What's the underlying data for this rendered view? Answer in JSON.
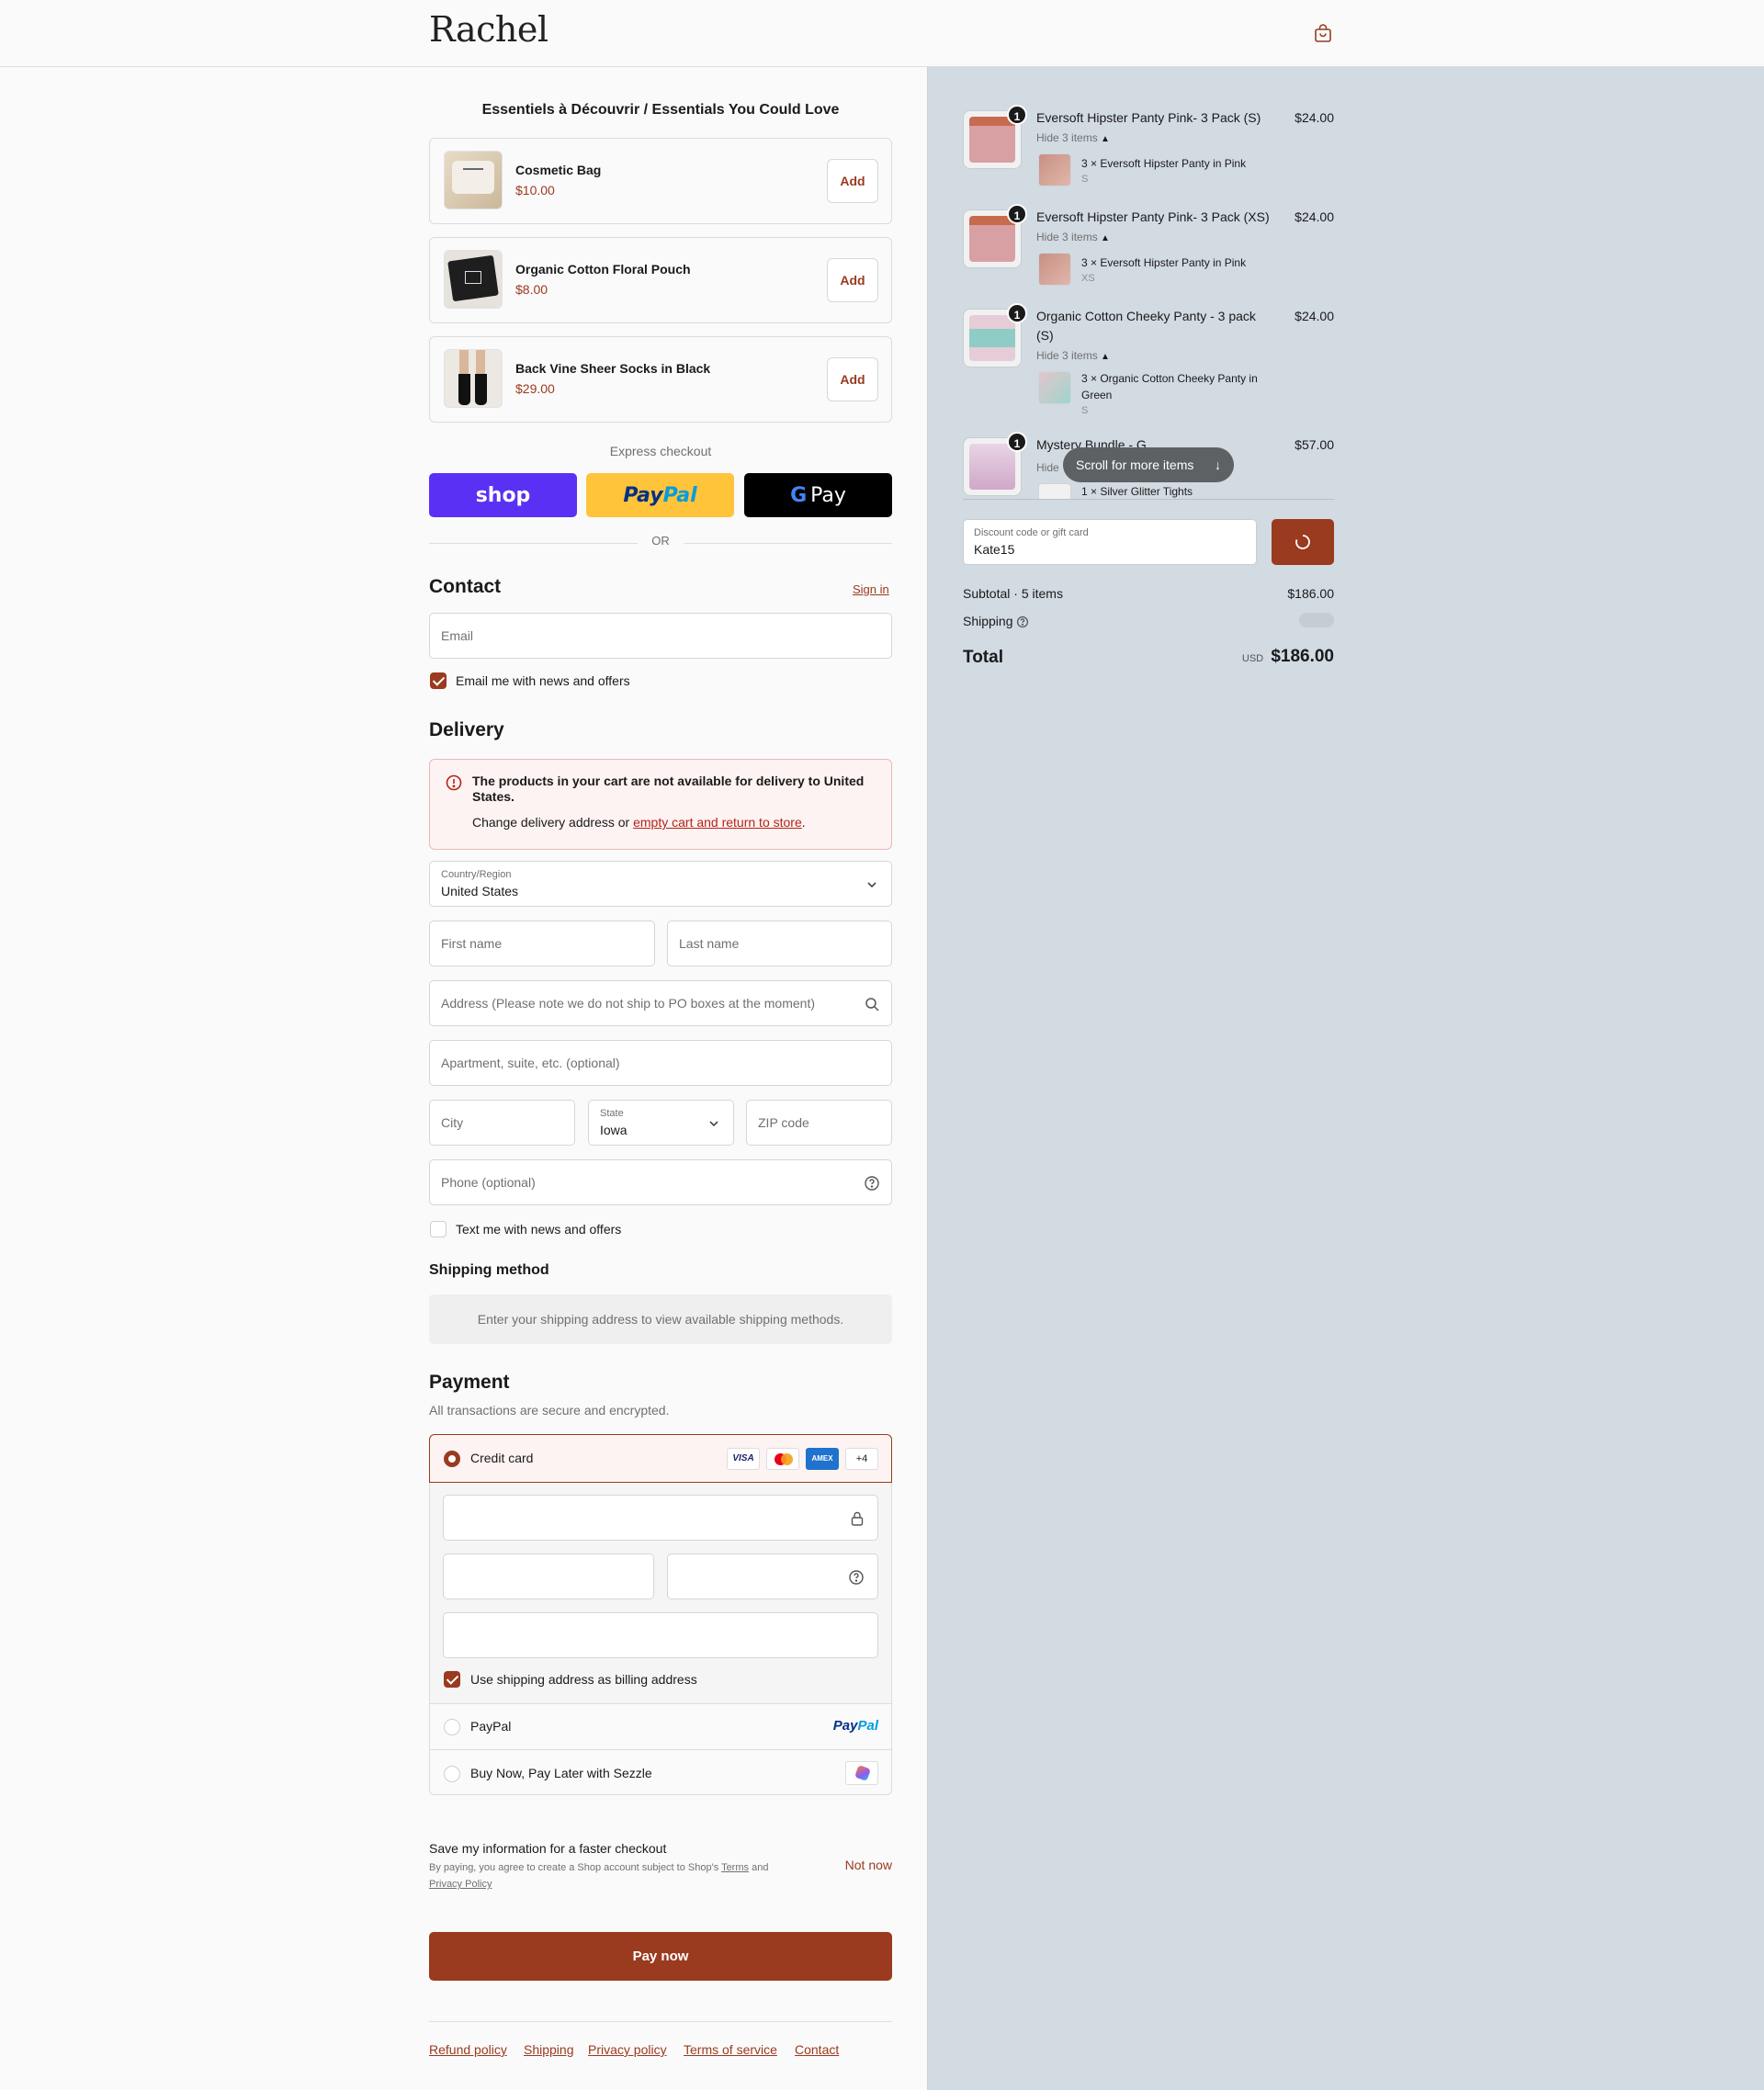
{
  "header": {
    "logo": "Rachel",
    "cart_icon": "shopping-bag-icon"
  },
  "essentials": {
    "title": "Essentiels à Découvrir / Essentials You Could Love",
    "items": [
      {
        "name": "Cosmetic Bag",
        "price": "$10.00",
        "add_label": "Add"
      },
      {
        "name": "Organic Cotton Floral Pouch",
        "price": "$8.00",
        "add_label": "Add"
      },
      {
        "name": "Back Vine Sheer Socks in Black",
        "price": "$29.00",
        "add_label": "Add"
      }
    ]
  },
  "express": {
    "label": "Express checkout",
    "buttons": {
      "shop": "shop",
      "paypal_pay": "Pay",
      "paypal_pal": "Pal",
      "gpay": "Pay"
    },
    "colors": {
      "shop": "#5a31f4",
      "paypal": "#ffc439",
      "gpay": "#000000"
    },
    "or": "OR"
  },
  "contact": {
    "title": "Contact",
    "sign_in": "Sign in",
    "email_placeholder": "Email",
    "news_label": "Email me with news and offers",
    "news_checked": true
  },
  "delivery": {
    "title": "Delivery",
    "alert_title": "The products in your cart are not available for delivery to United States.",
    "alert_text": "Change delivery address or",
    "alert_link": "empty cart and return to store",
    "alert_end": ".",
    "country_label": "Country/Region",
    "country_value": "United States",
    "first_name": "First name",
    "last_name": "Last name",
    "address": "Address (Please note we do not ship to PO boxes at the moment)",
    "apartment": "Apartment, suite, etc. (optional)",
    "city": "City",
    "state_label": "State",
    "state_value": "Iowa",
    "zip": "ZIP code",
    "phone": "Phone (optional)",
    "text_label": "Text me with news and offers",
    "text_checked": false
  },
  "shipping_method": {
    "title": "Shipping method",
    "message": "Enter your shipping address to view available shipping methods."
  },
  "payment": {
    "title": "Payment",
    "subtitle": "All transactions are secure and encrypted.",
    "credit_card": "Credit card",
    "card_brands": [
      "VISA",
      "AMEX"
    ],
    "more_brands": "+4",
    "billing_label": "Use shipping address as billing address",
    "billing_checked": true,
    "paypal": "PayPal",
    "paypal_logo_pay": "Pay",
    "paypal_logo_pal": "Pal",
    "sezzle": "Buy Now, Pay Later with Sezzle"
  },
  "save_info": {
    "title": "Save my information for a faster checkout",
    "text_before": "By paying, you agree to create a Shop account subject to Shop's",
    "terms": "Terms",
    "and": "and",
    "privacy": "Privacy Policy",
    "not_now": "Not now"
  },
  "pay_now": "Pay now",
  "footer_links": [
    "Refund policy",
    "Shipping",
    "Privacy policy",
    "Terms of service",
    "Contact"
  ],
  "order_summary": {
    "items": [
      {
        "qty": "1",
        "name": "Eversoft Hipster Panty Pink- 3 Pack (S)",
        "price": "$24.00",
        "hide": "Hide 3 items",
        "sub_name": "3 × Eversoft Hipster Panty in Pink",
        "sub_variant": "S"
      },
      {
        "qty": "1",
        "name": "Eversoft Hipster Panty Pink- 3 Pack (XS)",
        "price": "$24.00",
        "hide": "Hide 3 items",
        "sub_name": "3 × Eversoft Hipster Panty in Pink",
        "sub_variant": "XS"
      },
      {
        "qty": "1",
        "name_line1": "Organic Cotton Cheeky Panty - 3 pack",
        "name_line2": "(S)",
        "price": "$24.00",
        "hide": "Hide 3 items",
        "sub_name_line1": "3 × Organic Cotton Cheeky Panty in",
        "sub_name_line2": "Green",
        "sub_variant": "S"
      },
      {
        "qty": "1",
        "name": "Mystery Bundle - G",
        "price": "$57.00",
        "hide": "Hide",
        "sub_name": "1 × Silver Glitter Tights"
      }
    ],
    "scroll_hint": "Scroll for more items",
    "discount_label": "Discount code or gift card",
    "discount_value": "Kate15",
    "subtotal_label": "Subtotal · 5 items",
    "subtotal_value": "$186.00",
    "shipping_label": "Shipping",
    "total_label": "Total",
    "currency": "USD",
    "total_value": "$186.00"
  }
}
